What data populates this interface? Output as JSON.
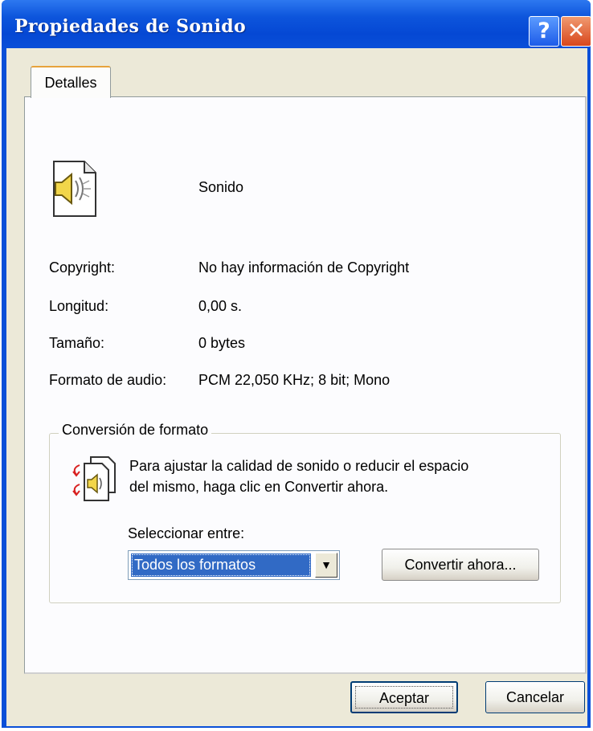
{
  "window": {
    "title": "Propiedades de Sonido",
    "help_symbol": "?",
    "close_symbol": "✕"
  },
  "tab": {
    "label": "Detalles"
  },
  "file": {
    "name": "Sonido",
    "icon": "speaker-file-icon"
  },
  "details": [
    {
      "label": "Copyright:",
      "value": "No hay información de Copyright"
    },
    {
      "label": "Longitud:",
      "value": "0,00 s."
    },
    {
      "label": "Tamaño:",
      "value": "0 bytes"
    },
    {
      "label": "Formato de audio:",
      "value": "PCM 22,050 KHz; 8 bit; Mono"
    }
  ],
  "conversion": {
    "group_title": "Conversión de formato",
    "description_line1": "Para ajustar la calidad de sonido o reducir el espacio",
    "description_line2": "del mismo, haga clic en Convertir ahora.",
    "select_label": "Seleccionar entre:",
    "selected_option": "Todos los formatos",
    "convert_button": "Convertir ahora..."
  },
  "buttons": {
    "ok": "Aceptar",
    "cancel": "Cancelar"
  },
  "colors": {
    "titlebar": "#0a4fd8",
    "dialog_bg": "#ece9d8",
    "selection": "#316ac5"
  }
}
